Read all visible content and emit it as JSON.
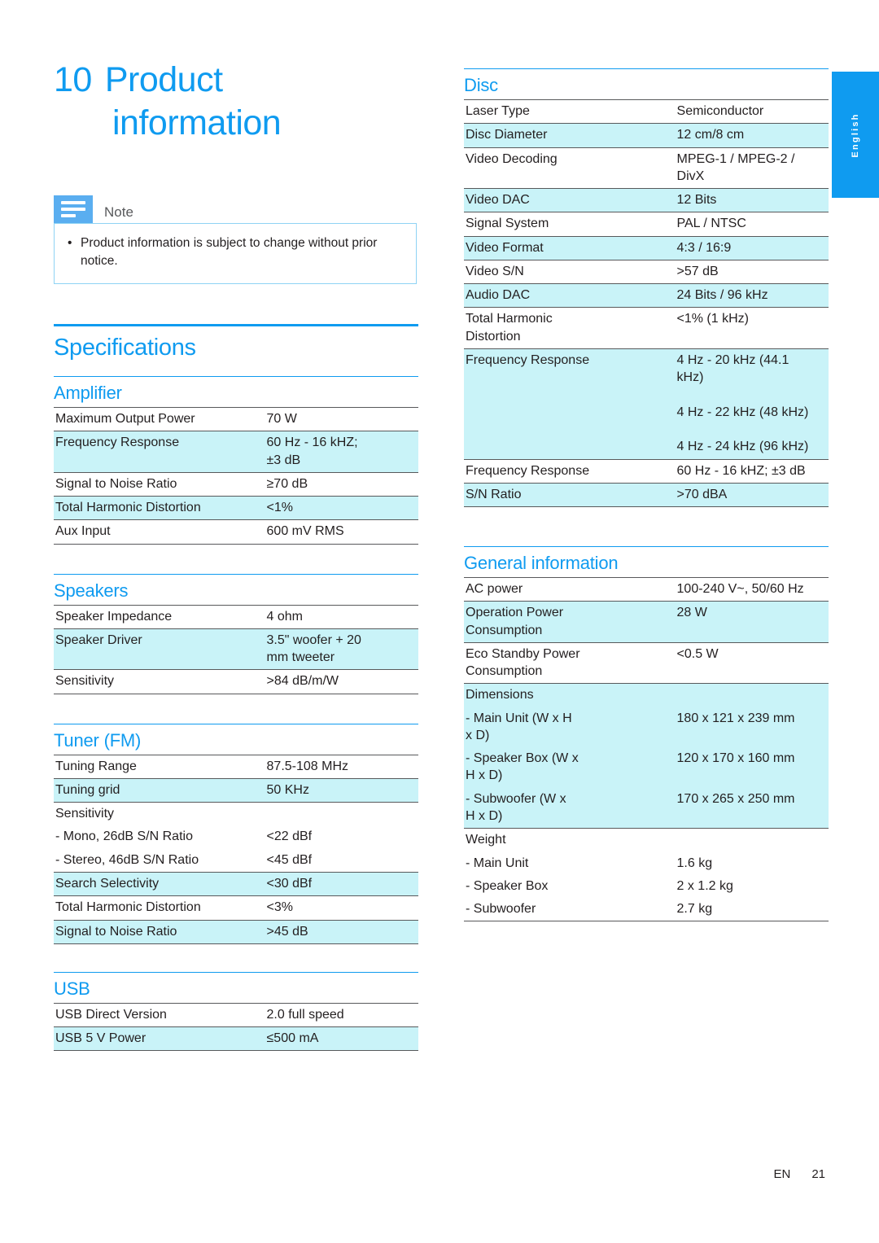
{
  "language_tab": "English",
  "chapter": {
    "number": "10",
    "title_line1": "Product",
    "title_line2": "information"
  },
  "note": {
    "label": "Note",
    "bullet": "•",
    "text": "Product information is subject to change without prior notice."
  },
  "specifications": {
    "heading": "Specifications"
  },
  "sections": {
    "amplifier": {
      "heading": "Amplifier",
      "rows": [
        {
          "k": "Maximum Output Power",
          "v": "70 W",
          "shade": false
        },
        {
          "k": "Frequency Response",
          "v": "60 Hz - 16 kHZ;\n±3 dB",
          "shade": true
        },
        {
          "k": "Signal to Noise Ratio",
          "v": "≥70 dB",
          "shade": false
        },
        {
          "k": "Total Harmonic Distortion",
          "v": "<1%",
          "shade": true
        },
        {
          "k": "Aux Input",
          "v": "600 mV RMS",
          "shade": false
        }
      ]
    },
    "speakers": {
      "heading": "Speakers",
      "rows": [
        {
          "k": "Speaker Impedance",
          "v": "4 ohm",
          "shade": false
        },
        {
          "k": "Speaker Driver",
          "v": "3.5\" woofer + 20\nmm tweeter",
          "shade": true
        },
        {
          "k": "Sensitivity",
          "v": ">84 dB/m/W",
          "shade": false
        }
      ]
    },
    "tuner": {
      "heading": "Tuner (FM)",
      "rows": [
        {
          "k": "Tuning Range",
          "v": "87.5-108 MHz",
          "shade": false
        },
        {
          "k": "Tuning grid",
          "v": "50 KHz",
          "shade": true
        },
        {
          "k": "Sensitivity",
          "v": "",
          "shade": false,
          "noline": true
        },
        {
          "k": "- Mono, 26dB S/N Ratio",
          "v": "<22 dBf",
          "shade": false,
          "noline": true
        },
        {
          "k": "- Stereo, 46dB S/N Ratio",
          "v": "<45 dBf",
          "shade": false
        },
        {
          "k": "Search Selectivity",
          "v": "<30 dBf",
          "shade": true
        },
        {
          "k": "Total Harmonic Distortion",
          "v": "<3%",
          "shade": false
        },
        {
          "k": "Signal to Noise Ratio",
          "v": ">45 dB",
          "shade": true
        }
      ]
    },
    "usb": {
      "heading": "USB",
      "rows": [
        {
          "k": "USB Direct Version",
          "v": "2.0 full speed",
          "shade": false
        },
        {
          "k": "USB 5 V Power",
          "v": "≤500 mA",
          "shade": true
        }
      ]
    },
    "disc": {
      "heading": "Disc",
      "rows": [
        {
          "k": "Laser Type",
          "v": "Semiconductor",
          "shade": false
        },
        {
          "k": "Disc Diameter",
          "v": "12 cm/8 cm",
          "shade": true
        },
        {
          "k": "Video Decoding",
          "v": "MPEG-1 / MPEG-2 /\nDivX",
          "shade": false
        },
        {
          "k": "Video DAC",
          "v": "12 Bits",
          "shade": true
        },
        {
          "k": "Signal System",
          "v": "PAL / NTSC",
          "shade": false
        },
        {
          "k": "Video Format",
          "v": "4:3 / 16:9",
          "shade": true
        },
        {
          "k": "Video S/N",
          "v": ">57 dB",
          "shade": false
        },
        {
          "k": "Audio DAC",
          "v": "24 Bits / 96 kHz",
          "shade": true
        },
        {
          "k": "Total Harmonic\nDistortion",
          "v": "<1% (1 kHz)",
          "shade": false
        },
        {
          "k": "Frequency Response",
          "v": "4 Hz - 20 kHz (44.1\nkHz)\n\n4 Hz - 22 kHz (48 kHz)\n\n4 Hz - 24 kHz (96 kHz)",
          "shade": true
        },
        {
          "k": "Frequency Response",
          "v": "60 Hz - 16 kHZ; ±3 dB",
          "shade": false
        },
        {
          "k": "S/N Ratio",
          "v": ">70 dBA",
          "shade": true
        }
      ]
    },
    "general": {
      "heading": "General information",
      "rows": [
        {
          "k": "AC power",
          "v": "100-240 V~, 50/60 Hz",
          "shade": false
        },
        {
          "k": "Operation Power\nConsumption",
          "v": "28 W",
          "shade": true
        },
        {
          "k": "Eco Standby Power\nConsumption",
          "v": "<0.5 W",
          "shade": false
        },
        {
          "k": "Dimensions",
          "v": "",
          "shade": true,
          "noline": true
        },
        {
          "k": "- Main Unit (W x H\n x D)",
          "v": "180 x 121 x 239 mm",
          "shade": true,
          "noline": true
        },
        {
          "k": "- Speaker Box (W x\n H x D)",
          "v": "120 x 170 x 160 mm",
          "shade": true,
          "noline": true
        },
        {
          "k": "- Subwoofer (W x\n H x D)",
          "v": "170 x 265 x 250 mm",
          "shade": true
        },
        {
          "k": "Weight",
          "v": "",
          "shade": false,
          "noline": true
        },
        {
          "k": "- Main Unit",
          "v": "1.6 kg",
          "shade": false,
          "noline": true
        },
        {
          "k": "- Speaker Box",
          "v": "2 x 1.2 kg",
          "shade": false,
          "noline": true
        },
        {
          "k": "- Subwoofer",
          "v": "2.7 kg",
          "shade": false
        }
      ]
    }
  },
  "footer": {
    "locale": "EN",
    "page": "21"
  }
}
